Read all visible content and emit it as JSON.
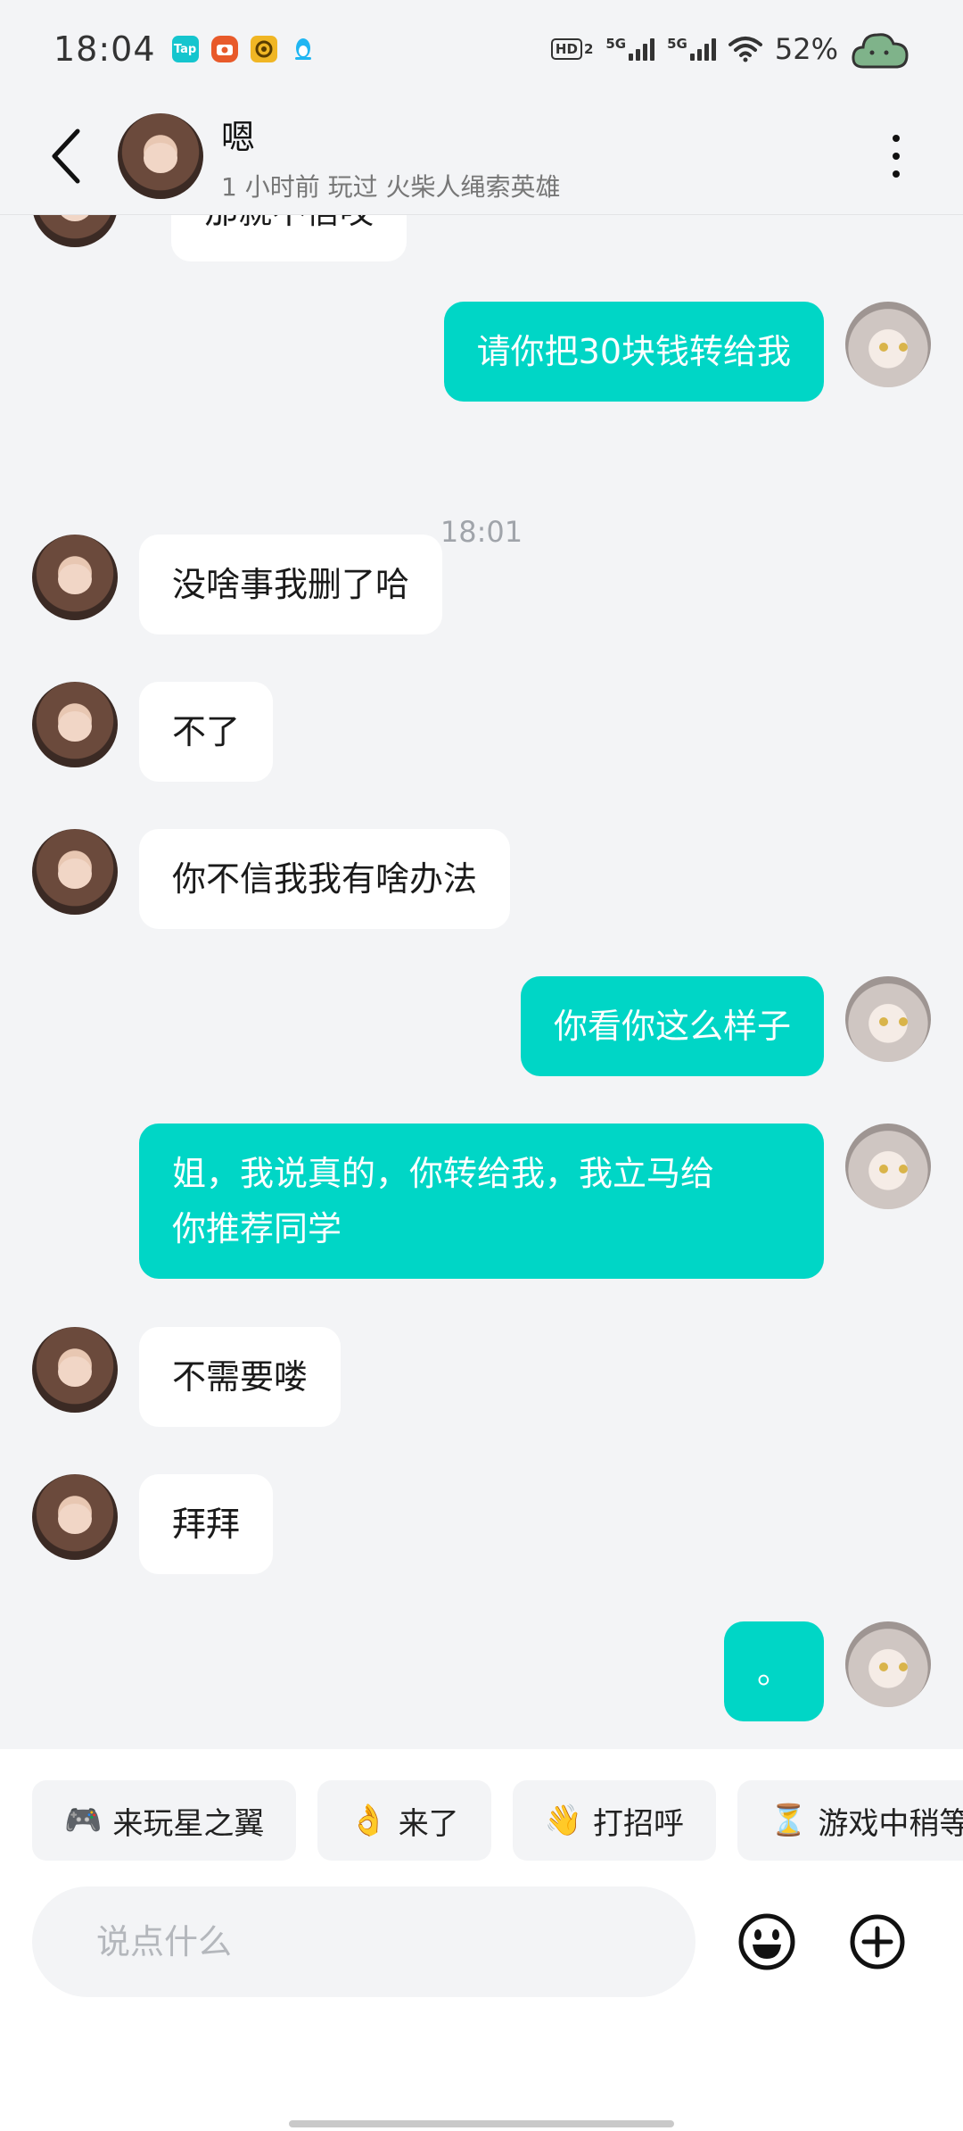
{
  "status_bar": {
    "time": "18:04",
    "app_icons": [
      "tap-app-icon",
      "camera-app-icon",
      "ring-app-icon",
      "qq-penguin-icon"
    ],
    "tap_label": "Tap",
    "hd_label": "HD",
    "hd_sub": "2",
    "network_1": "5G",
    "network_2": "5G",
    "battery": "52%"
  },
  "header": {
    "name": "嗯",
    "subtitle": "1 小时前  玩过  火柴人绳索英雄"
  },
  "messages": [
    {
      "side": "in",
      "text": "那就不信哎"
    },
    {
      "side": "out",
      "text": "请你把30块钱转给我"
    },
    {
      "side": "in",
      "text": "没啥事我删了哈"
    },
    {
      "side": "in",
      "text": "不了"
    },
    {
      "side": "in",
      "text": "你不信我我有啥办法"
    },
    {
      "side": "out",
      "text": "你看你这么样子"
    },
    {
      "side": "out",
      "text": "姐，我说真的，你转给我，我立马给\n你推荐同学"
    },
    {
      "side": "in",
      "text": "不需要喽"
    },
    {
      "side": "in",
      "text": "拜拜"
    },
    {
      "side": "out",
      "text": "。"
    }
  ],
  "timestamp": "18:01",
  "quick_replies": [
    {
      "emoji": "🎮",
      "label": "来玩星之翼"
    },
    {
      "emoji": "👌",
      "label": "来了"
    },
    {
      "emoji": "👋",
      "label": "打招呼"
    },
    {
      "emoji": "⏳",
      "label": "游戏中稍等"
    }
  ],
  "input": {
    "placeholder": "说点什么",
    "value": ""
  },
  "colors": {
    "accent": "#00d6c6",
    "background": "#f3f4f6"
  }
}
